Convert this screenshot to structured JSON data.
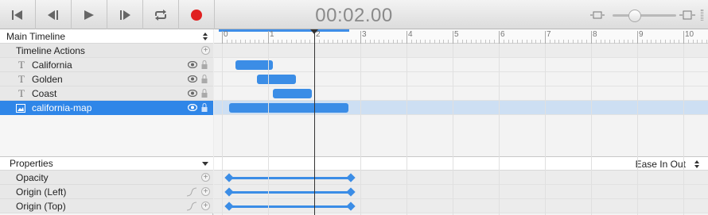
{
  "toolbar": {
    "time": "00:02.00",
    "buttons": [
      "skip-to-start",
      "step-back",
      "play",
      "step-forward",
      "loop",
      "record"
    ],
    "record_color": "#e02020",
    "zoom_level": 0.35
  },
  "timeline": {
    "title": "Main Timeline",
    "actions_label": "Timeline Actions",
    "layers": [
      {
        "label": "California",
        "type": "text",
        "start": 0.3,
        "end": 1.1
      },
      {
        "label": "Golden",
        "type": "text",
        "start": 0.75,
        "end": 1.6
      },
      {
        "label": "Coast",
        "type": "text",
        "start": 1.1,
        "end": 1.95
      },
      {
        "label": "california-map",
        "type": "image",
        "start": 0.15,
        "end": 2.75,
        "selected": true
      }
    ],
    "ruler_ticks": [
      "0",
      "1",
      "2",
      "3",
      "4",
      "5",
      "6",
      "7",
      "8",
      "9",
      "10"
    ],
    "playhead_time": 2.0,
    "accent": "#3b8de6"
  },
  "properties": {
    "title": "Properties",
    "easing": "Ease In Out",
    "rows": [
      {
        "label": "Opacity",
        "from": 0.15,
        "to": 2.8
      },
      {
        "label": "Origin (Left)",
        "from": 0.15,
        "to": 2.8
      },
      {
        "label": "Origin (Top)",
        "from": 0.15,
        "to": 2.8
      }
    ]
  }
}
